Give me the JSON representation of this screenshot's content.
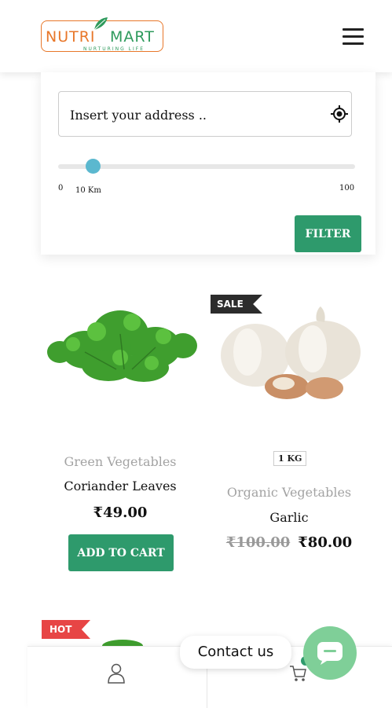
{
  "brand": {
    "name_part1": "NUTRI",
    "name_part2": "MART",
    "tagline": "NURTURING LIFE",
    "color_orange": "#e8772a",
    "color_green": "#2e9a5c"
  },
  "header": {
    "menu_icon": "hamburger-icon"
  },
  "filter": {
    "address_placeholder": "Insert your address ..",
    "location_icon": "crosshair-icon",
    "range_min": "0",
    "range_max": "100",
    "range_value_label": "10 Km",
    "range_value": 10,
    "button_label": "FILTER"
  },
  "products": [
    {
      "category": "Green Vegetables",
      "name": "Coriander Leaves",
      "price": "₹49.00",
      "button_label": "ADD TO CART"
    },
    {
      "badge": "SALE",
      "weight": "1 KG",
      "category": "Organic Vegetables",
      "name": "Garlic",
      "old_price": "₹100.00",
      "price": "₹80.00"
    },
    {
      "badge": "HOT"
    }
  ],
  "bottom_bar": {
    "user_icon": "user-icon",
    "cart_icon": "cart-icon"
  },
  "contact": {
    "label": "Contact us",
    "icon": "chat-icon"
  },
  "colors": {
    "accent": "#2e9a6c",
    "slider": "#5bb8cf",
    "hot": "#e74545",
    "sale": "#2c2c2c",
    "fab": "#7fcf98"
  }
}
